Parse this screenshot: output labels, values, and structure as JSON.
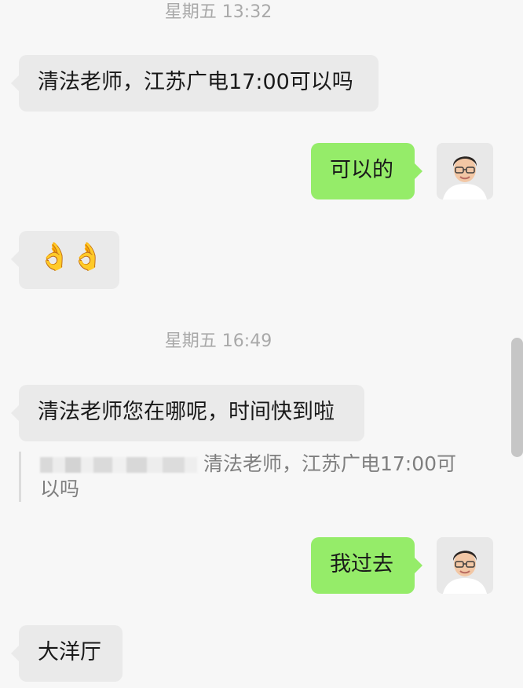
{
  "timestamps": [
    "星期五 13:32",
    "星期五 16:49"
  ],
  "messages": {
    "m1": "清法老师，江苏广电17:00可以吗",
    "m2": "可以的",
    "m3_emoji": "👌👌",
    "m4": "清法老师您在哪呢，时间快到啦",
    "quote_text": "清法老师，江苏广电17:00可以吗",
    "m5": "我过去",
    "m6": "大洋厅"
  },
  "colors": {
    "background": "#f7f7f7",
    "incoming_bubble": "#eaeaea",
    "outgoing_bubble": "#95ec69",
    "timestamp_text": "#a9a9a9"
  },
  "icons": {
    "avatar": "avatar-icon",
    "emoji": "ok-hand-icon"
  }
}
